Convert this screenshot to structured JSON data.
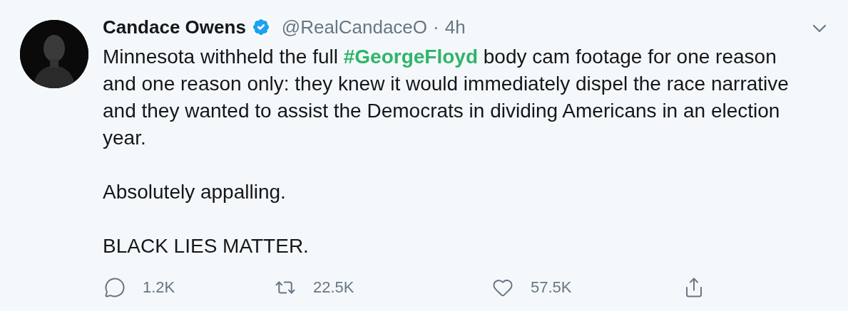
{
  "tweet": {
    "author": {
      "name": "Candace Owens",
      "verified": true,
      "handle": "@RealCandaceO",
      "separator": "·",
      "time": "4h"
    },
    "paragraphs": [
      {
        "before": "Minnesota withheld the full ",
        "hashtag": "#GeorgeFloyd",
        "after": " body cam footage for one reason and one reason only: they knew it would immediately dispel the race narrative and they wanted to assist the Democrats in dividing Americans in an election year."
      },
      {
        "text": "Absolutely appalling."
      },
      {
        "text": "BLACK LIES MATTER."
      }
    ],
    "actions": [
      {
        "kind": "reply",
        "count": "1.2K"
      },
      {
        "kind": "retweet",
        "count": "22.5K"
      },
      {
        "kind": "like",
        "count": "57.5K"
      },
      {
        "kind": "share"
      }
    ]
  }
}
